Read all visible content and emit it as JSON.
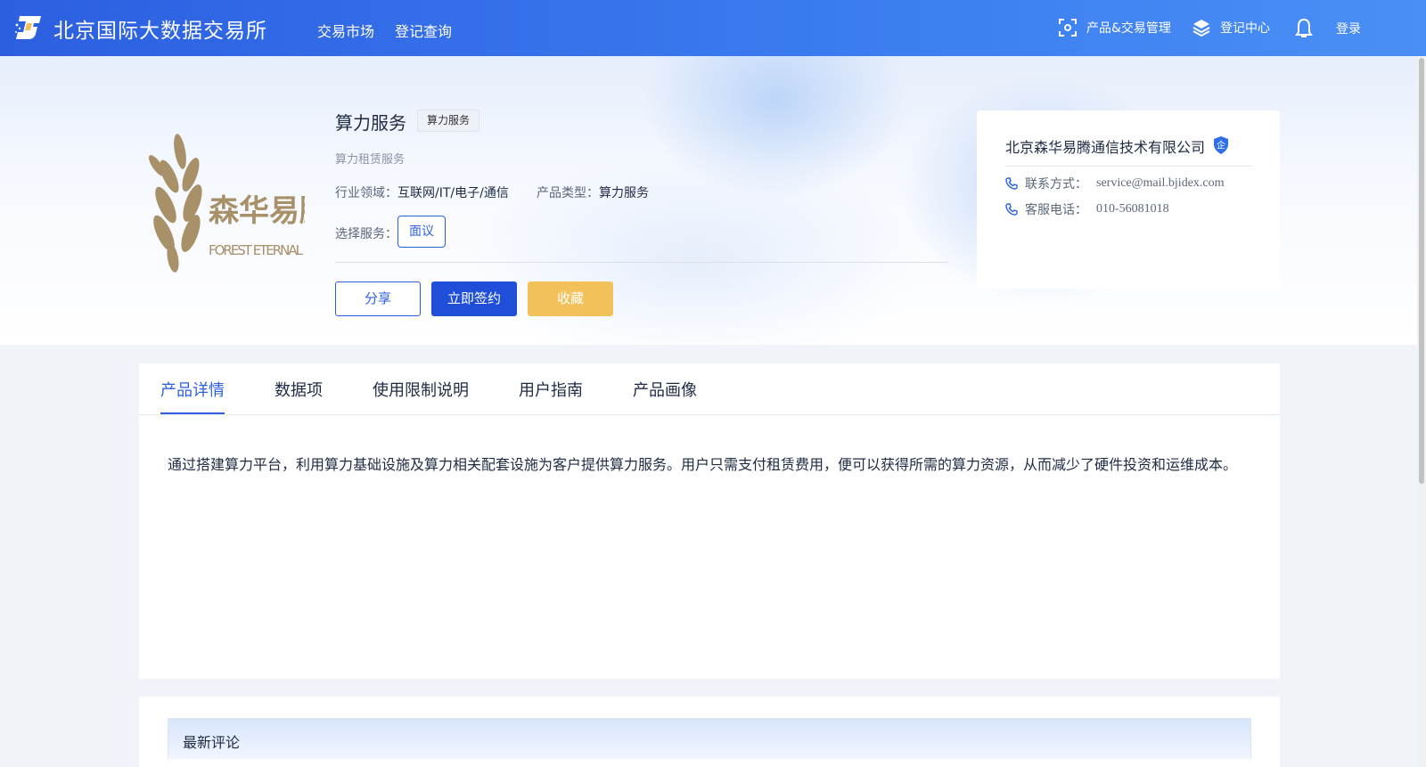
{
  "header": {
    "site_name": "北京国际大数据交易所",
    "nav": [
      "交易市场",
      "登记查询"
    ],
    "product_trade_mgmt": "产品&交易管理",
    "registry_center": "登记中心",
    "login": "登录"
  },
  "product": {
    "logo_text_cn": "森华易腾",
    "logo_text_en": "FOREST ETERNAL",
    "title": "算力服务",
    "tag": "算力服务",
    "subtitle": "算力租赁服务",
    "industry_label": "行业领域：",
    "industry_value": "互联网/IT/电子/通信",
    "type_label": "产品类型：",
    "type_value": "算力服务",
    "select_label": "选择服务：",
    "select_option": "面议",
    "share": "分享",
    "sign": "立即签约",
    "favorite": "收藏"
  },
  "company": {
    "name": "北京森华易腾通信技术有限公司",
    "badge": "企",
    "contact_label": "联系方式：",
    "contact_value": "service@mail.bjidex.com",
    "phone_label": "客服电话：",
    "phone_value": "010-56081018"
  },
  "tabs": [
    "产品详情",
    "数据项",
    "使用限制说明",
    "用户指南",
    "产品画像"
  ],
  "detail_text": "通过搭建算力平台，利用算力基础设施及算力相关配套设施为客户提供算力服务。用户只需支付租赁费用，便可以获得所需的算力资源，从而减少了硬件投资和运维成本。",
  "comments": {
    "title": "最新评论"
  },
  "colors": {
    "primary": "#2c5fe0",
    "sign_button": "#1f4fd8",
    "favorite_button": "#f3c15a"
  }
}
